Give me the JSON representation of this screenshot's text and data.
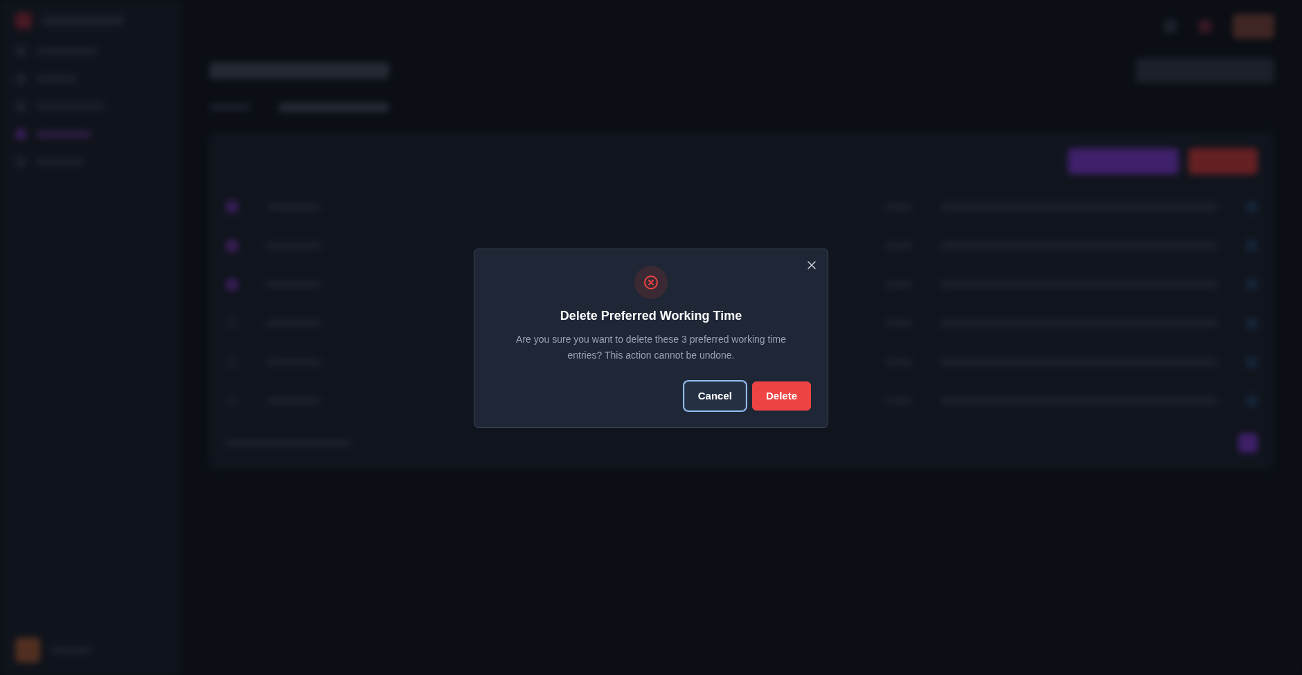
{
  "dialog": {
    "title": "Delete Preferred Working Time",
    "message": "Are you sure you want to delete these 3 preferred working time entries? This action cannot be undone.",
    "buttons": [
      {
        "label": "Cancel",
        "kind": "secondary",
        "focused": true
      },
      {
        "label": "Delete",
        "kind": "danger",
        "focused": false
      }
    ]
  }
}
